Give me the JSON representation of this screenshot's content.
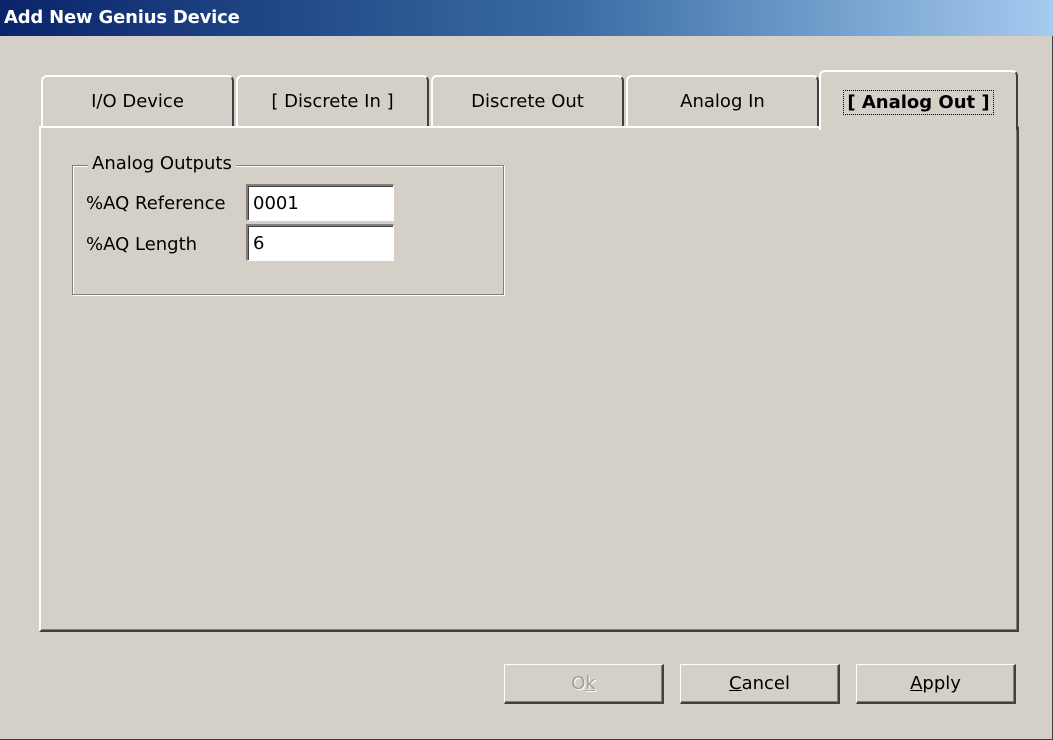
{
  "window": {
    "title": "Add New Genius Device"
  },
  "tabs": [
    {
      "label": "I/O Device",
      "active": false
    },
    {
      "label": "[ Discrete In ]",
      "active": false
    },
    {
      "label": "Discrete Out",
      "active": false
    },
    {
      "label": "Analog In",
      "active": false
    },
    {
      "label": "[ Analog Out ]",
      "active": true
    }
  ],
  "group": {
    "title": "Analog Outputs",
    "reference_label": "%AQ Reference",
    "reference_value": "0001",
    "length_label": "%AQ Length",
    "length_value": "6"
  },
  "buttons": {
    "ok": {
      "mnemonic_prefix": "O",
      "mnemonic_char": "k",
      "enabled": false
    },
    "cancel": {
      "mnemonic_char": "C",
      "rest": "ancel",
      "enabled": true
    },
    "apply": {
      "mnemonic_char": "A",
      "rest": "pply",
      "enabled": true
    }
  }
}
